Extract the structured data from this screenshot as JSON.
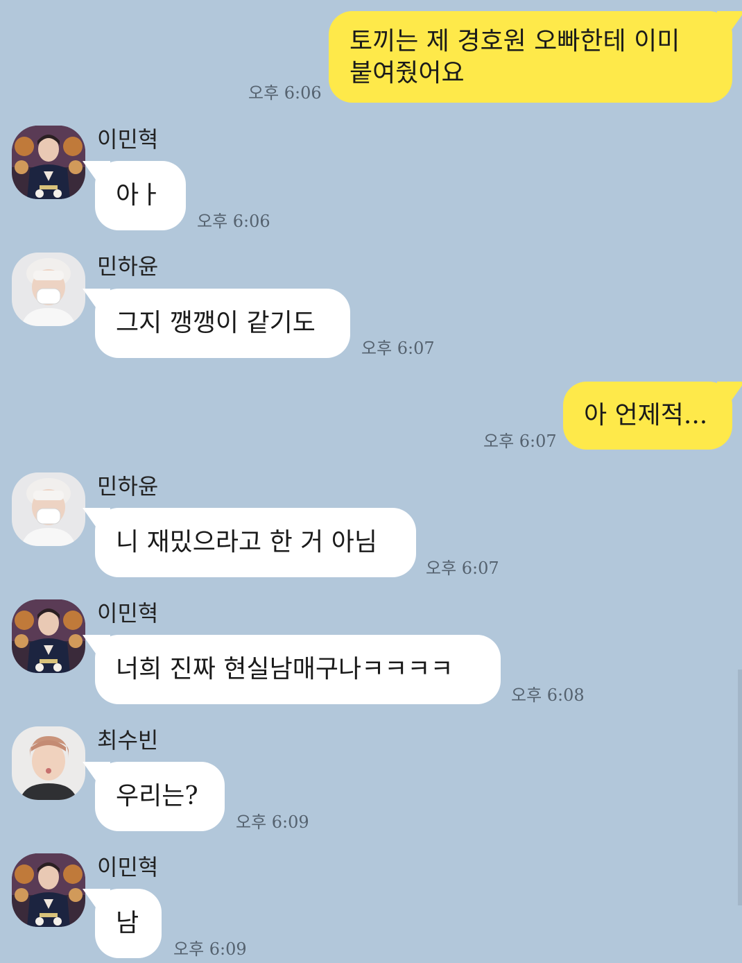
{
  "chat": {
    "messages": [
      {
        "type": "out",
        "text": "토끼는 제 경호원 오빠한테 이미\n붙여줬어요",
        "time": "오후 6:06"
      },
      {
        "type": "in",
        "sender": "이민혁",
        "avatar": "avatar-minhyuk",
        "text": "아ㅏ",
        "time": "오후 6:06"
      },
      {
        "type": "in",
        "sender": "민하윤",
        "avatar": "avatar-hayoon",
        "text": "그지 깽깽이 같기도",
        "time": "오후 6:07"
      },
      {
        "type": "out",
        "text": "아 언제적...",
        "time": "오후 6:07"
      },
      {
        "type": "in",
        "sender": "민하윤",
        "avatar": "avatar-hayoon",
        "text": "니 재밌으라고 한 거 아님",
        "time": "오후 6:07"
      },
      {
        "type": "in",
        "sender": "이민혁",
        "avatar": "avatar-minhyuk",
        "text": "너희 진짜 현실남매구나ㅋㅋㅋㅋ",
        "time": "오후 6:08"
      },
      {
        "type": "in",
        "sender": "최수빈",
        "avatar": "avatar-soobin",
        "text": "우리는?",
        "time": "오후 6:09"
      },
      {
        "type": "in",
        "sender": "이민혁",
        "avatar": "avatar-minhyuk",
        "text": "남",
        "time": "오후 6:09"
      }
    ]
  },
  "colors": {
    "background": "#b2c7da",
    "outgoing_bubble": "#fee94a",
    "incoming_bubble": "#ffffff"
  }
}
